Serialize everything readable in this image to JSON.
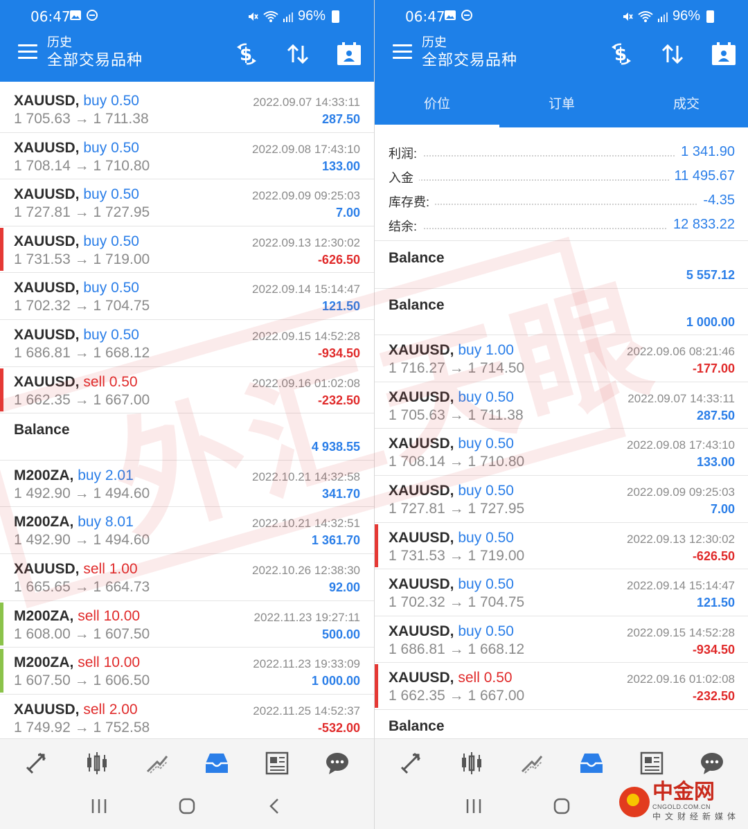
{
  "status": {
    "time": "06:47",
    "battery": "96%"
  },
  "header": {
    "subtitle": "历史",
    "title": "全部交易品种"
  },
  "tabs": [
    "价位",
    "订单",
    "成交"
  ],
  "summary": [
    {
      "label": "利润:",
      "value": "1 341.90"
    },
    {
      "label": "入金",
      "value": "11 495.67"
    },
    {
      "label": "库存费:",
      "value": "-4.35"
    },
    {
      "label": "结余:",
      "value": "12 833.22"
    }
  ],
  "left_rows": [
    {
      "kind": "deal",
      "symbol": "XAUUSD,",
      "side": "buy",
      "volume": "0.50",
      "open": "1 705.63",
      "close": "1 711.38",
      "time": "2022.09.07 14:33:11",
      "profit": "287.50",
      "sign": "pos",
      "mark": ""
    },
    {
      "kind": "deal",
      "symbol": "XAUUSD,",
      "side": "buy",
      "volume": "0.50",
      "open": "1 708.14",
      "close": "1 710.80",
      "time": "2022.09.08 17:43:10",
      "profit": "133.00",
      "sign": "pos",
      "mark": ""
    },
    {
      "kind": "deal",
      "symbol": "XAUUSD,",
      "side": "buy",
      "volume": "0.50",
      "open": "1 727.81",
      "close": "1 727.95",
      "time": "2022.09.09 09:25:03",
      "profit": "7.00",
      "sign": "pos",
      "mark": ""
    },
    {
      "kind": "deal",
      "symbol": "XAUUSD,",
      "side": "buy",
      "volume": "0.50",
      "open": "1 731.53",
      "close": "1 719.00",
      "time": "2022.09.13 12:30:02",
      "profit": "-626.50",
      "sign": "neg",
      "mark": "red"
    },
    {
      "kind": "deal",
      "symbol": "XAUUSD,",
      "side": "buy",
      "volume": "0.50",
      "open": "1 702.32",
      "close": "1 704.75",
      "time": "2022.09.14 15:14:47",
      "profit": "121.50",
      "sign": "pos",
      "mark": ""
    },
    {
      "kind": "deal",
      "symbol": "XAUUSD,",
      "side": "buy",
      "volume": "0.50",
      "open": "1 686.81",
      "close": "1 668.12",
      "time": "2022.09.15 14:52:28",
      "profit": "-934.50",
      "sign": "neg",
      "mark": ""
    },
    {
      "kind": "deal",
      "symbol": "XAUUSD,",
      "side": "sell",
      "volume": "0.50",
      "open": "1 662.35",
      "close": "1 667.00",
      "time": "2022.09.16 01:02:08",
      "profit": "-232.50",
      "sign": "neg",
      "mark": "red"
    },
    {
      "kind": "balance",
      "label": "Balance",
      "profit": "4 938.55",
      "sign": "pos"
    },
    {
      "kind": "deal",
      "symbol": "M200ZA,",
      "side": "buy",
      "volume": "2.01",
      "open": "1 492.90",
      "close": "1 494.60",
      "time": "2022.10.21 14:32:58",
      "profit": "341.70",
      "sign": "pos",
      "mark": ""
    },
    {
      "kind": "deal",
      "symbol": "M200ZA,",
      "side": "buy",
      "volume": "8.01",
      "open": "1 492.90",
      "close": "1 494.60",
      "time": "2022.10.21 14:32:51",
      "profit": "1 361.70",
      "sign": "pos",
      "mark": ""
    },
    {
      "kind": "deal",
      "symbol": "XAUUSD,",
      "side": "sell",
      "volume": "1.00",
      "open": "1 665.65",
      "close": "1 664.73",
      "time": "2022.10.26 12:38:30",
      "profit": "92.00",
      "sign": "pos",
      "mark": ""
    },
    {
      "kind": "deal",
      "symbol": "M200ZA,",
      "side": "sell",
      "volume": "10.00",
      "open": "1 608.00",
      "close": "1 607.50",
      "time": "2022.11.23 19:27:11",
      "profit": "500.00",
      "sign": "pos",
      "mark": "green"
    },
    {
      "kind": "deal",
      "symbol": "M200ZA,",
      "side": "sell",
      "volume": "10.00",
      "open": "1 607.50",
      "close": "1 606.50",
      "time": "2022.11.23 19:33:09",
      "profit": "1 000.00",
      "sign": "pos",
      "mark": "green"
    },
    {
      "kind": "deal",
      "symbol": "XAUUSD,",
      "side": "sell",
      "volume": "2.00",
      "open": "1 749.92",
      "close": "1 752.58",
      "time": "2022.11.25 14:52:37",
      "profit": "-532.00",
      "sign": "neg",
      "mark": ""
    }
  ],
  "right_rows": [
    {
      "kind": "balance",
      "label": "Balance",
      "profit": "5 557.12",
      "sign": "pos"
    },
    {
      "kind": "balance",
      "label": "Balance",
      "profit": "1 000.00",
      "sign": "pos"
    },
    {
      "kind": "deal",
      "symbol": "XAUUSD,",
      "side": "buy",
      "volume": "1.00",
      "open": "1 716.27",
      "close": "1 714.50",
      "time": "2022.09.06 08:21:46",
      "profit": "-177.00",
      "sign": "neg",
      "mark": ""
    },
    {
      "kind": "deal",
      "symbol": "XAUUSD,",
      "side": "buy",
      "volume": "0.50",
      "open": "1 705.63",
      "close": "1 711.38",
      "time": "2022.09.07 14:33:11",
      "profit": "287.50",
      "sign": "pos",
      "mark": ""
    },
    {
      "kind": "deal",
      "symbol": "XAUUSD,",
      "side": "buy",
      "volume": "0.50",
      "open": "1 708.14",
      "close": "1 710.80",
      "time": "2022.09.08 17:43:10",
      "profit": "133.00",
      "sign": "pos",
      "mark": ""
    },
    {
      "kind": "deal",
      "symbol": "XAUUSD,",
      "side": "buy",
      "volume": "0.50",
      "open": "1 727.81",
      "close": "1 727.95",
      "time": "2022.09.09 09:25:03",
      "profit": "7.00",
      "sign": "pos",
      "mark": ""
    },
    {
      "kind": "deal",
      "symbol": "XAUUSD,",
      "side": "buy",
      "volume": "0.50",
      "open": "1 731.53",
      "close": "1 719.00",
      "time": "2022.09.13 12:30:02",
      "profit": "-626.50",
      "sign": "neg",
      "mark": "red"
    },
    {
      "kind": "deal",
      "symbol": "XAUUSD,",
      "side": "buy",
      "volume": "0.50",
      "open": "1 702.32",
      "close": "1 704.75",
      "time": "2022.09.14 15:14:47",
      "profit": "121.50",
      "sign": "pos",
      "mark": ""
    },
    {
      "kind": "deal",
      "symbol": "XAUUSD,",
      "side": "buy",
      "volume": "0.50",
      "open": "1 686.81",
      "close": "1 668.12",
      "time": "2022.09.15 14:52:28",
      "profit": "-934.50",
      "sign": "neg",
      "mark": ""
    },
    {
      "kind": "deal",
      "symbol": "XAUUSD,",
      "side": "sell",
      "volume": "0.50",
      "open": "1 662.35",
      "close": "1 667.00",
      "time": "2022.09.16 01:02:08",
      "profit": "-232.50",
      "sign": "neg",
      "mark": "red"
    },
    {
      "kind": "balance",
      "label": "Balance",
      "profit": "",
      "sign": "pos"
    }
  ],
  "colors": {
    "header": "#1e80e8",
    "buy": "#2a7ee8",
    "sell": "#e02a2a",
    "marker_red": "#e53935",
    "marker_green": "#8bc34a"
  },
  "watermark": {
    "text": "外汇天眼"
  },
  "logo": {
    "name": "中金网",
    "url": "CNGOLD.COM.CN",
    "tagline": "中文财经新媒体"
  }
}
